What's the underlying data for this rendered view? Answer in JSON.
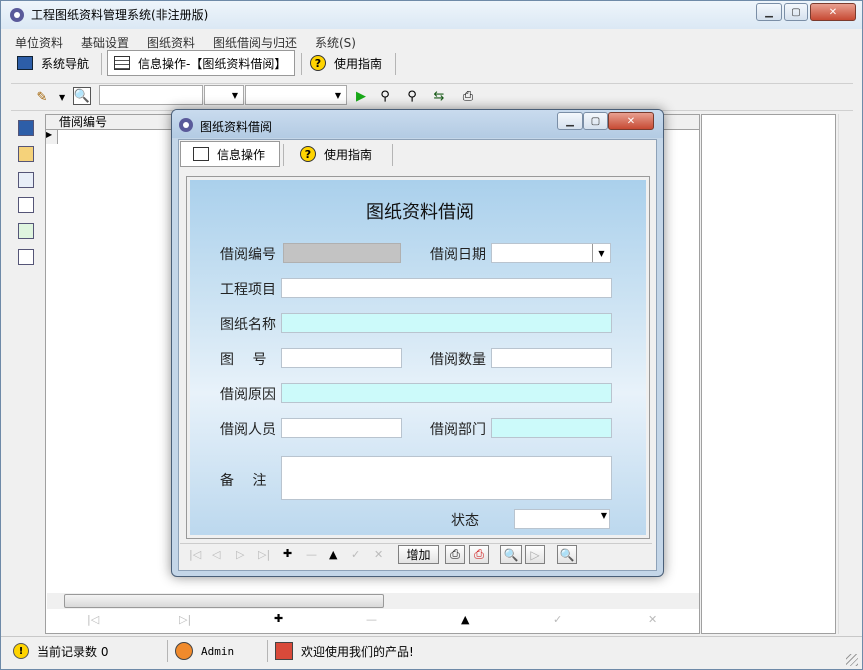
{
  "window": {
    "title": "工程图纸资料管理系统(非注册版)"
  },
  "menu": [
    "单位资料",
    "基础设置",
    "图纸资料",
    "图纸借阅与归还",
    "系统(S)"
  ],
  "tabs": [
    {
      "label": "系统导航"
    },
    {
      "label": "信息操作-【图纸资料借阅】"
    },
    {
      "label": "使用指南"
    }
  ],
  "grid": {
    "columns": [
      "借阅编号"
    ]
  },
  "dialog": {
    "title": "图纸资料借阅",
    "tabs": [
      "信息操作",
      "使用指南"
    ],
    "form_title": "图纸资料借阅",
    "labels": {
      "borrow_no": "借阅编号",
      "borrow_date": "借阅日期",
      "project": "工程项目",
      "drawing_name": "图纸名称",
      "drawing_no": "图　 号",
      "quantity": "借阅数量",
      "reason": "借阅原因",
      "person": "借阅人员",
      "dept": "借阅部门",
      "remark": "备　 注",
      "status": "状态"
    },
    "add_button": "增加"
  },
  "status_bar": {
    "records": "当前记录数 0",
    "user": "Admin",
    "welcome": "欢迎使用我们的产品!"
  }
}
